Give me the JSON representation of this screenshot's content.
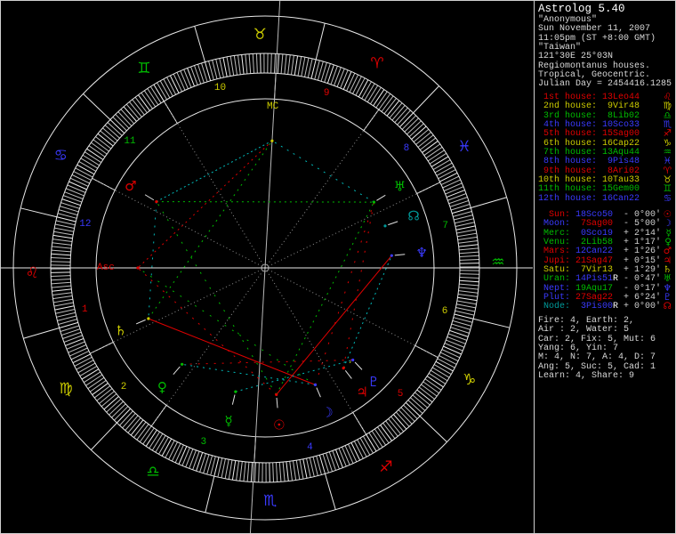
{
  "palette": {
    "fire": "#e00000",
    "earth": "#cccc00",
    "air": "#00bb00",
    "water": "#3a3aff",
    "red": "#e00000",
    "yellow": "#cccc00",
    "green": "#00bb00",
    "blue": "#3a3aff",
    "teal": "#009999",
    "white": "#ffffff",
    "dim": "#d0d0d0",
    "wheel_line": "#e8e8e8",
    "tick": "#bdbdbd",
    "tick5": "#f0f0f0",
    "spoke": "#8f8f8f",
    "asc_axis": "#e8e8e8",
    "mc_axis": "#b8b8b8",
    "pointer": "#e0e0e0",
    "center_dot": "#999999",
    "aspect_conjunction": "#cccc00",
    "aspect_sextile": "#00b8b8",
    "aspect_square": "#e00000",
    "aspect_trine": "#00bb00"
  },
  "panel": {
    "title": "Astrolog 5.40",
    "header": [
      "\"Anonymous\"",
      "Sun November 11, 2007",
      "11:05pm (ST +8:00 GMT)",
      "\"Taiwan\"",
      "121°30E 25°03N",
      "Regiomontanus houses.",
      "Tropical, Geocentric.",
      "Julian Day = 2454416.1285"
    ],
    "houses": [
      {
        "ord": "1st",
        "value": "13Leo44",
        "element": "fire",
        "glyph": "♌"
      },
      {
        "ord": "2nd",
        "value": "9Vir48",
        "element": "earth",
        "glyph": "♍"
      },
      {
        "ord": "3rd",
        "value": "8Lib02",
        "element": "air",
        "glyph": "♎"
      },
      {
        "ord": "4th",
        "value": "10Sco33",
        "element": "water",
        "glyph": "♏"
      },
      {
        "ord": "5th",
        "value": "15Sag00",
        "element": "fire",
        "glyph": "♐"
      },
      {
        "ord": "6th",
        "value": "16Cap22",
        "element": "earth",
        "glyph": "♑"
      },
      {
        "ord": "7th",
        "value": "13Aqu44",
        "element": "air",
        "glyph": "♒"
      },
      {
        "ord": "8th",
        "value": "9Pis48",
        "element": "water",
        "glyph": "♓"
      },
      {
        "ord": "9th",
        "value": "8Ari02",
        "element": "fire",
        "glyph": "♈"
      },
      {
        "ord": "10th",
        "value": "10Tau33",
        "element": "earth",
        "glyph": "♉"
      },
      {
        "ord": "11th",
        "value": "15Gem00",
        "element": "air",
        "glyph": "♊"
      },
      {
        "ord": "12th",
        "value": "16Can22",
        "element": "water",
        "glyph": "♋"
      }
    ],
    "planets": [
      {
        "name": "Sun",
        "value": "18Sco50",
        "retro": false,
        "offset": "- 0°00'",
        "label_color": "red",
        "value_color": "water",
        "glyph": "☉",
        "glyph_color": "red"
      },
      {
        "name": "Moon",
        "value": "7Sag00",
        "retro": false,
        "offset": "- 5°00'",
        "label_color": "water",
        "value_color": "fire",
        "glyph": "☽",
        "glyph_color": "water"
      },
      {
        "name": "Merc",
        "value": "0Sco19",
        "retro": false,
        "offset": "+ 2°14'",
        "label_color": "green",
        "value_color": "water",
        "glyph": "☿",
        "glyph_color": "green"
      },
      {
        "name": "Venu",
        "value": "2Lib58",
        "retro": false,
        "offset": "+ 1°17'",
        "label_color": "green",
        "value_color": "air",
        "glyph": "♀",
        "glyph_color": "green"
      },
      {
        "name": "Mars",
        "value": "12Can22",
        "retro": false,
        "offset": "+ 1°26'",
        "label_color": "red",
        "value_color": "water",
        "glyph": "♂",
        "glyph_color": "red"
      },
      {
        "name": "Jupi",
        "value": "21Sag47",
        "retro": false,
        "offset": "+ 0°15'",
        "label_color": "red",
        "value_color": "fire",
        "glyph": "♃",
        "glyph_color": "red"
      },
      {
        "name": "Satu",
        "value": "7Vir13",
        "retro": false,
        "offset": "+ 1°29'",
        "label_color": "yellow",
        "value_color": "earth",
        "glyph": "♄",
        "glyph_color": "yellow"
      },
      {
        "name": "Uran",
        "value": "14Pis51",
        "retro": true,
        "offset": "- 0°47'",
        "label_color": "green",
        "value_color": "water",
        "glyph": "♅",
        "glyph_color": "green"
      },
      {
        "name": "Nept",
        "value": "19Aqu17",
        "retro": false,
        "offset": "- 0°17'",
        "label_color": "water",
        "value_color": "air",
        "glyph": "♆",
        "glyph_color": "water"
      },
      {
        "name": "Plut",
        "value": "27Sag22",
        "retro": false,
        "offset": "+ 6°24'",
        "label_color": "water",
        "value_color": "fire",
        "glyph": "♇",
        "glyph_color": "water"
      },
      {
        "name": "Node",
        "value": "3Pis00",
        "retro": true,
        "offset": "+ 0°00'",
        "label_color": "teal",
        "value_color": "water",
        "glyph": "☊",
        "glyph_color": "red"
      }
    ],
    "stats": [
      "Fire: 4, Earth: 2,",
      "Air : 2, Water: 5",
      "Car: 2, Fix: 5, Mut: 6",
      "Yang: 6, Yin: 7",
      "M: 4, N: 7, A: 4, D: 7",
      "Ang: 5, Suc: 5, Cad: 1",
      "Learn: 4, Share: 9"
    ]
  },
  "wheel": {
    "asc_label": "Asc",
    "mc_label": "MC",
    "house_cusps_deg": [
      133.733,
      159.8,
      188.033,
      220.55,
      255.0,
      286.367,
      313.733,
      339.8,
      8.033,
      40.55,
      75.0,
      106.367
    ],
    "house_numbers": [
      "1",
      "2",
      "3",
      "4",
      "5",
      "6",
      "7",
      "8",
      "9",
      "10",
      "11",
      "12"
    ],
    "signs": [
      {
        "name": "aries",
        "glyph": "♈",
        "element": "fire"
      },
      {
        "name": "taurus",
        "glyph": "♉",
        "element": "earth"
      },
      {
        "name": "gemini",
        "glyph": "♊",
        "element": "air"
      },
      {
        "name": "cancer",
        "glyph": "♋",
        "element": "water"
      },
      {
        "name": "leo",
        "glyph": "♌",
        "element": "fire"
      },
      {
        "name": "virgo",
        "glyph": "♍",
        "element": "earth"
      },
      {
        "name": "libra",
        "glyph": "♎",
        "element": "air"
      },
      {
        "name": "scorpio",
        "glyph": "♏",
        "element": "water"
      },
      {
        "name": "sagittarius",
        "glyph": "♐",
        "element": "fire"
      },
      {
        "name": "capricorn",
        "glyph": "♑",
        "element": "earth"
      },
      {
        "name": "aquarius",
        "glyph": "♒",
        "element": "air"
      },
      {
        "name": "pisces",
        "glyph": "♓",
        "element": "water"
      }
    ],
    "planets": [
      {
        "name": "sun",
        "glyph": "☉",
        "deg": 228.833,
        "color": "red"
      },
      {
        "name": "moon",
        "glyph": "☽",
        "deg": 247.0,
        "color": "water"
      },
      {
        "name": "mercury",
        "glyph": "☿",
        "deg": 210.317,
        "color": "green"
      },
      {
        "name": "venus",
        "glyph": "♀",
        "deg": 182.967,
        "color": "green"
      },
      {
        "name": "mars",
        "glyph": "♂",
        "deg": 102.367,
        "color": "red"
      },
      {
        "name": "jupiter",
        "glyph": "♃",
        "deg": 261.783,
        "color": "red"
      },
      {
        "name": "saturn",
        "glyph": "♄",
        "deg": 157.217,
        "color": "yellow"
      },
      {
        "name": "uranus",
        "glyph": "♅",
        "deg": 344.85,
        "color": "green"
      },
      {
        "name": "neptune",
        "glyph": "♆",
        "deg": 319.283,
        "color": "water"
      },
      {
        "name": "pluto",
        "glyph": "♇",
        "deg": 267.367,
        "color": "water"
      },
      {
        "name": "node",
        "glyph": "☊",
        "deg": 333.0,
        "color": "teal"
      }
    ],
    "angles": [
      {
        "name": "asc",
        "deg": 133.733,
        "color": "red"
      },
      {
        "name": "mc",
        "deg": 40.55,
        "color": "yellow"
      }
    ],
    "aspects": [
      {
        "a": "moon",
        "b": "saturn",
        "type": "square",
        "orb": 0.22
      },
      {
        "a": "sun",
        "b": "neptune",
        "type": "square",
        "orb": 0.45
      },
      {
        "a": "mars",
        "b": "mc",
        "type": "sextile",
        "orb": 1.82
      },
      {
        "a": "mars",
        "b": "uranus",
        "type": "trine",
        "orb": 2.48
      },
      {
        "a": "jupiter",
        "b": "neptune",
        "type": "sextile",
        "orb": 2.5
      },
      {
        "a": "mercury",
        "b": "pluto",
        "type": "sextile",
        "orb": 2.95
      },
      {
        "a": "mc",
        "b": "asc",
        "type": "square",
        "orb": 3.18
      },
      {
        "a": "saturn",
        "b": "mc",
        "type": "trine",
        "orb": 3.33
      },
      {
        "a": "sun",
        "b": "uranus",
        "type": "trine",
        "orb": 3.98
      },
      {
        "a": "moon",
        "b": "venus",
        "type": "sextile",
        "orb": 4.03
      },
      {
        "a": "uranus",
        "b": "mc",
        "type": "sextile",
        "orb": 4.3
      },
      {
        "a": "sun",
        "b": "asc",
        "type": "square",
        "orb": 5.1
      },
      {
        "a": "mars",
        "b": "saturn",
        "type": "sextile",
        "orb": 5.15
      },
      {
        "a": "jupiter",
        "b": "pluto",
        "type": "conjunction",
        "orb": 5.59
      },
      {
        "a": "venus",
        "b": "pluto",
        "type": "square",
        "orb": 5.6
      },
      {
        "a": "sun",
        "b": "mars",
        "type": "trine",
        "orb": 6.46
      },
      {
        "a": "moon",
        "b": "asc",
        "type": "trine",
        "orb": 6.73
      },
      {
        "a": "jupiter",
        "b": "uranus",
        "type": "square",
        "orb": 6.93
      },
      {
        "a": "moon",
        "b": "uranus",
        "type": "square",
        "orb": 7.85
      }
    ]
  }
}
